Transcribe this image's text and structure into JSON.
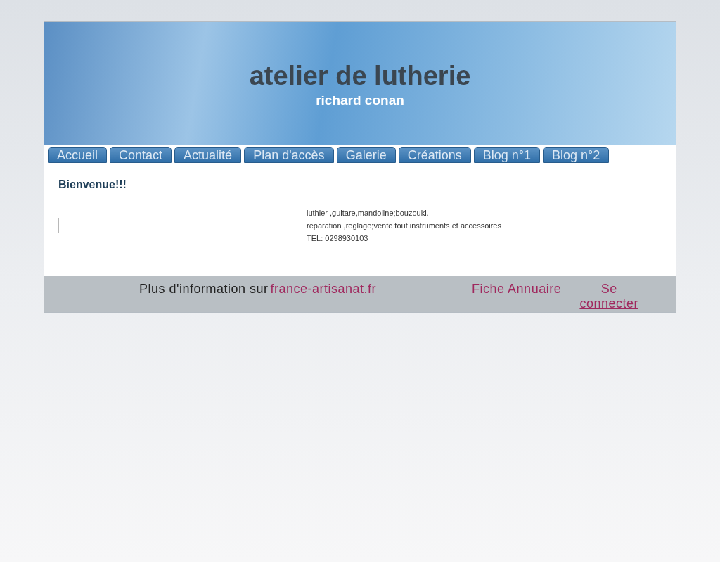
{
  "header": {
    "title": "atelier de lutherie",
    "subtitle": "richard conan"
  },
  "nav": [
    {
      "label": "Accueil",
      "selected": false
    },
    {
      "label": "Contact",
      "selected": false
    },
    {
      "label": "Actualité",
      "selected": false
    },
    {
      "label": "Plan d'accès",
      "selected": false
    },
    {
      "label": "Galerie",
      "selected": false
    },
    {
      "label": "Créations",
      "selected": false
    },
    {
      "label": "Blog n°1",
      "selected": false
    },
    {
      "label": "Blog n°2",
      "selected": false
    }
  ],
  "content": {
    "heading": "Bienvenue!!!",
    "lines": [
      "luthier ,guitare,mandoline;bouzouki.",
      "reparation ,reglage;vente tout instruments et accessoires",
      "TEL: 0298930103"
    ]
  },
  "footer": {
    "text": "Plus d'information sur",
    "site_link": "france-artisanat.fr",
    "links": [
      "Fiche Annuaire",
      "Se connecter"
    ]
  }
}
